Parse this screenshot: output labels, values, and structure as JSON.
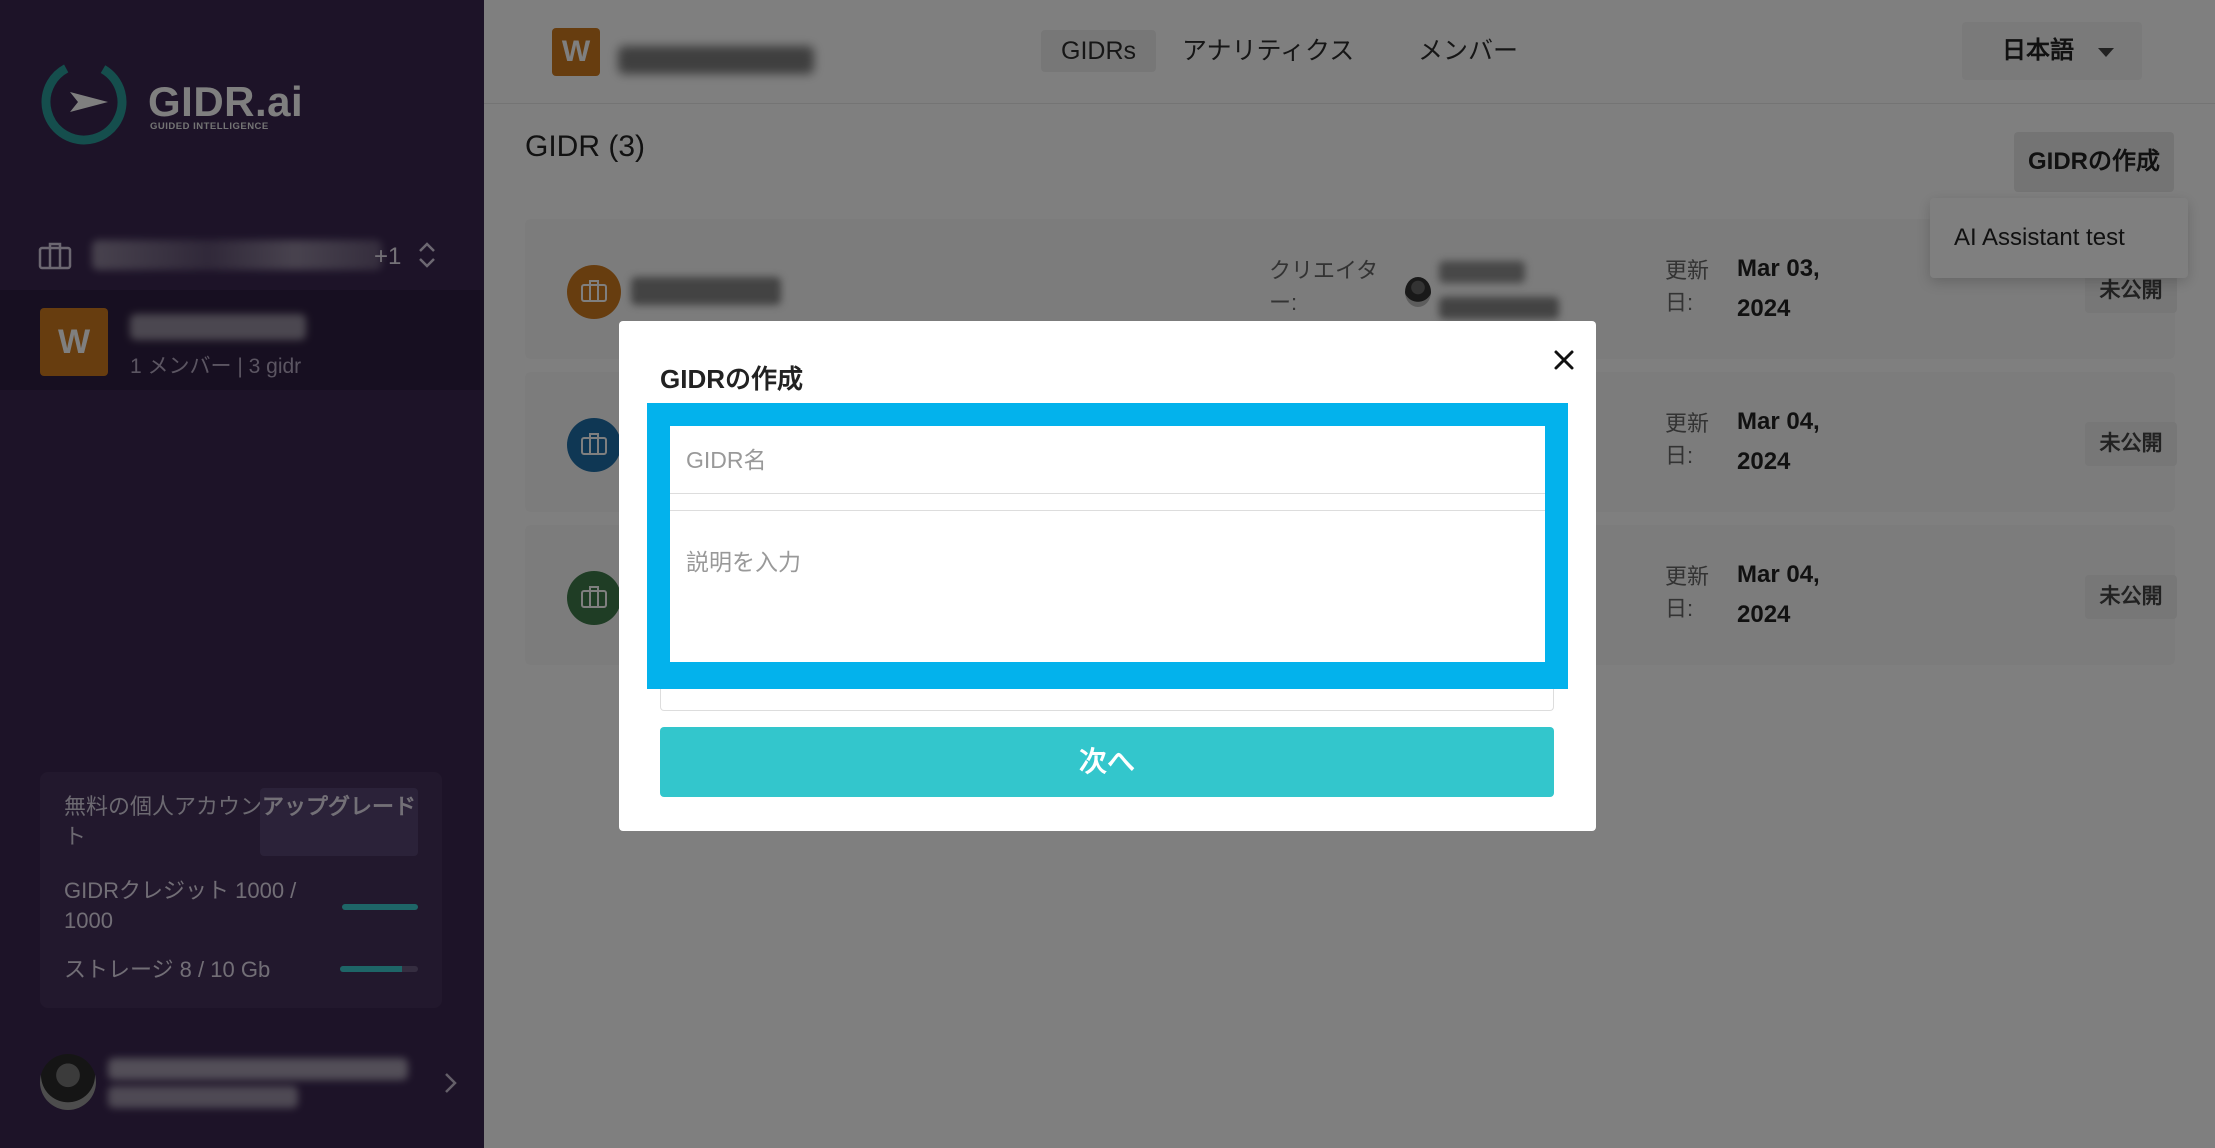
{
  "brand": {
    "name": "GIDR.ai",
    "tagline": "GUIDED INTELLIGENCE"
  },
  "sidebar": {
    "org_switch": {
      "extra_count": "+1"
    },
    "org": {
      "initial": "W",
      "meta": "1 メンバー | 3 gidr"
    },
    "account": {
      "plan_label": "無料の個人アカウント",
      "upgrade_label": "アップグレード",
      "credit_label": "GIDRクレジット 1000 / 1000",
      "credit_fraction": 1.0,
      "storage_label": "ストレージ 8 / 10 Gb",
      "storage_fraction": 0.8
    }
  },
  "topbar": {
    "workspace_initial": "W",
    "tabs": [
      {
        "label": "GIDRs",
        "active": true
      },
      {
        "label": "アナリティクス",
        "active": false
      },
      {
        "label": "メンバー",
        "active": false
      }
    ],
    "language": "日本語"
  },
  "main": {
    "title": "GIDR (3)",
    "create_button": "GIDRの作成",
    "dropdown_item": "AI Assistant test",
    "cards": [
      {
        "creator_label": "クリエイター:",
        "updated_label": "更新日:",
        "date": "Mar 03, 2024",
        "status": "未公開",
        "color": "#cf7a1f"
      },
      {
        "creator_label": "",
        "updated_label": "更新日:",
        "date": "Mar 04, 2024",
        "status": "未公開",
        "color": "#1f6fa8"
      },
      {
        "creator_label": "",
        "updated_label": "更新日:",
        "date": "Mar 04, 2024",
        "status": "未公開",
        "color": "#3e7a4a"
      }
    ]
  },
  "modal": {
    "title": "GIDRの作成",
    "name_placeholder": "GIDR名",
    "description_placeholder": "説明を入力",
    "next_button": "次へ",
    "highlight_color": "#03b2ec"
  }
}
